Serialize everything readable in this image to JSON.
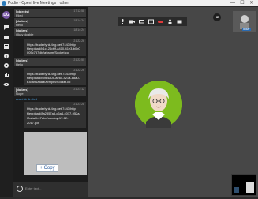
{
  "window": {
    "title": "Podio · OpenHive Meetings · other",
    "controls": {
      "minimize": "—",
      "maximize": "☐",
      "close": "✕"
    }
  },
  "sidebar": {
    "avatar_initials": "DG",
    "icons": [
      "chat-icon",
      "folder-icon",
      "list-icon",
      "info-icon",
      "settings-icon",
      "hand-icon",
      "eye-icon"
    ]
  },
  "chat": {
    "messages": [
      {
        "sender": "[objects]",
        "time": "17:12:58",
        "body": "Filed"
      },
      {
        "sender": "[dollars]",
        "time": "18:14:24",
        "body": "Hello"
      },
      {
        "sender": "[dollars]",
        "time": "18:14:24",
        "body": "Okay doable"
      }
    ],
    "link_cards": [
      {
        "time": "21:22:26",
        "lines": [
          "https://traderlynk.4ng.net:7443/http",
          "fileupload/b1c126d0f-a410-41e3-b0b0",
          "005c757db2a9apm/Socket.co"
        ]
      },
      {
        "time": "21:22:26",
        "lines": [
          "https://traderlynk.4ng.net:7443/http",
          "fileupload/b5fa4a0d-ae60-421a-88a0-",
          "b3da91a8aa00/mpm/Socket.co"
        ]
      },
      {
        "time": "21:23:28",
        "lines": [
          "https://traderlynk.4ng.net:7443/http",
          "fileupload/8a2857a3-c6a4-4017-952a-",
          "f2a0a0b17ebe/sunday-17-12-",
          "2017.pdf"
        ]
      }
    ],
    "dollar_messages": [
      {
        "sender": "[dollars]",
        "time": "21:22:50",
        "body": "Hello"
      },
      {
        "sender": "[dollars]",
        "time": "21:23:12",
        "body": "Nope"
      }
    ],
    "name_tag": "Arabi Unlimited",
    "copy_button": "Copy",
    "input_placeholder": "Enter text..."
  },
  "stage": {
    "toolbar_icons": [
      "microphone-icon",
      "camera-icon",
      "screen-share-icon",
      "window-icon",
      "phone-hangup-icon",
      "users-icon",
      "video-icon"
    ],
    "hd_badge": "HD",
    "self_thumb_label": "dollar"
  },
  "colors": {
    "avatar_bg": "#7dbb1e",
    "sidebar_bg": "#1f1f1f",
    "stage_bg": "#474747"
  }
}
